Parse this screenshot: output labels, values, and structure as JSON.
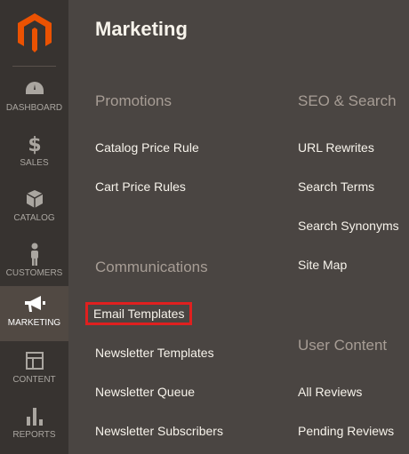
{
  "sidebar": {
    "items": [
      {
        "label": "DASHBOARD",
        "icon": "dashboard-icon"
      },
      {
        "label": "SALES",
        "icon": "dollar-icon"
      },
      {
        "label": "CATALOG",
        "icon": "box-icon"
      },
      {
        "label": "CUSTOMERS",
        "icon": "person-icon"
      },
      {
        "label": "MARKETING",
        "icon": "megaphone-icon",
        "active": true
      },
      {
        "label": "CONTENT",
        "icon": "layout-icon"
      },
      {
        "label": "REPORTS",
        "icon": "bar-chart-icon"
      }
    ]
  },
  "panel": {
    "title": "Marketing",
    "promotions": {
      "title": "Promotions",
      "links": [
        "Catalog Price Rule",
        "Cart Price Rules"
      ]
    },
    "communications": {
      "title": "Communications",
      "links": [
        "Email Templates",
        "Newsletter Templates",
        "Newsletter Queue",
        "Newsletter Subscribers"
      ]
    },
    "seo": {
      "title": "SEO & Search",
      "links": [
        "URL Rewrites",
        "Search Terms",
        "Search Synonyms",
        "Site Map"
      ]
    },
    "user_content": {
      "title": "User Content",
      "links": [
        "All Reviews",
        "Pending Reviews"
      ]
    }
  },
  "colors": {
    "accent": "#eb5202",
    "highlight": "#e0201f",
    "sidebar_bg": "#373330",
    "panel_bg": "#4a4542"
  }
}
